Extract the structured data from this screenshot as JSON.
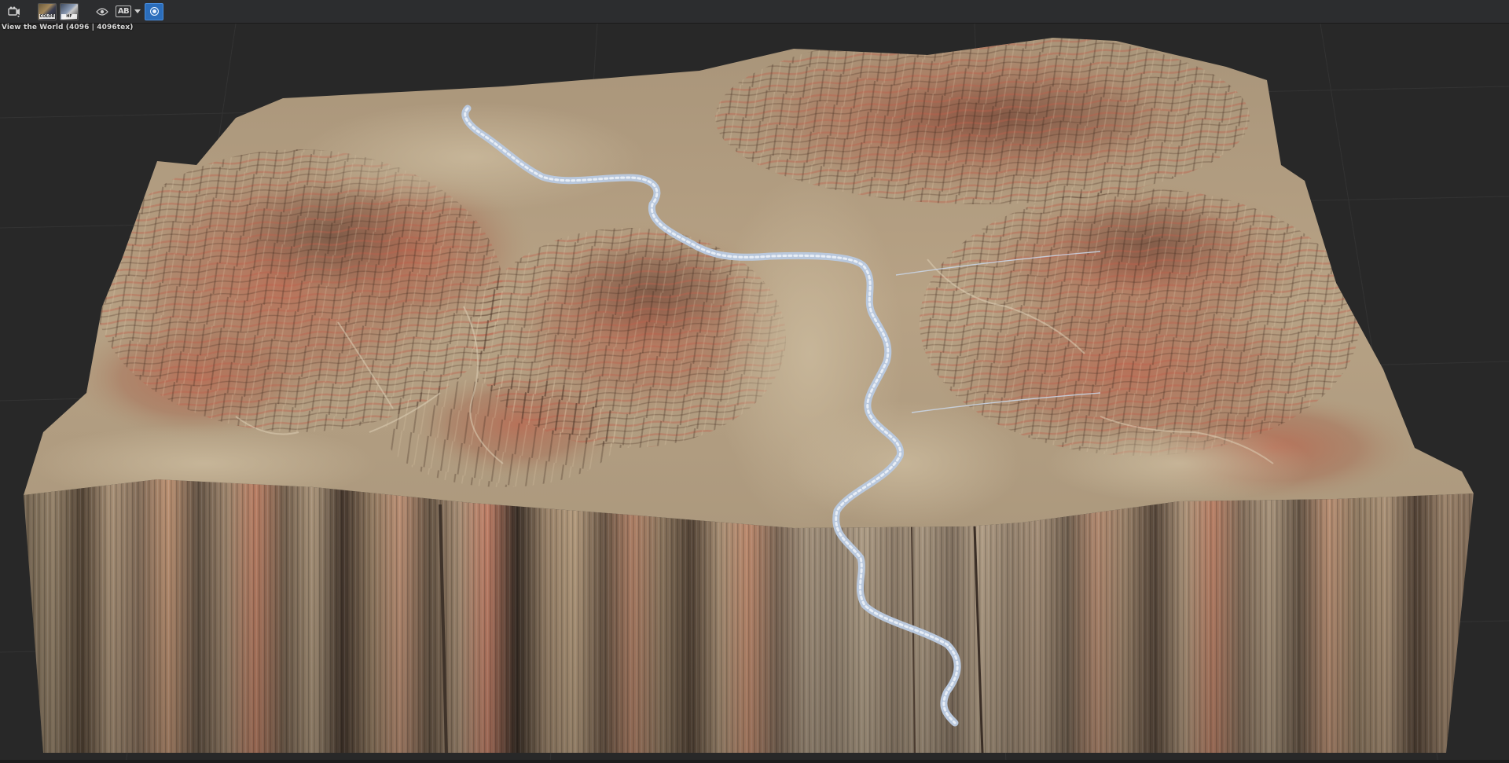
{
  "viewport": {
    "label": "View the World (4096 | 4096tex)"
  },
  "toolbar": {
    "items": [
      {
        "name": "camera-settings-icon"
      },
      {
        "name": "terrain-preview-thumbnail-icon",
        "caption": "COLOR"
      },
      {
        "name": "heightfield-preview-thumbnail-icon",
        "caption": "HF"
      },
      {
        "name": "visibility-eye-icon"
      },
      {
        "name": "ab-compare-dropdown",
        "label": "AB"
      },
      {
        "name": "render-mode-active-icon"
      }
    ]
  },
  "colors": {
    "background": "#282828",
    "toolbar": "#2c2d2f",
    "accent": "#2b6dbb",
    "river": "#b9c8dd",
    "sand": "#b9a484",
    "rock_red": "#b4674d"
  }
}
